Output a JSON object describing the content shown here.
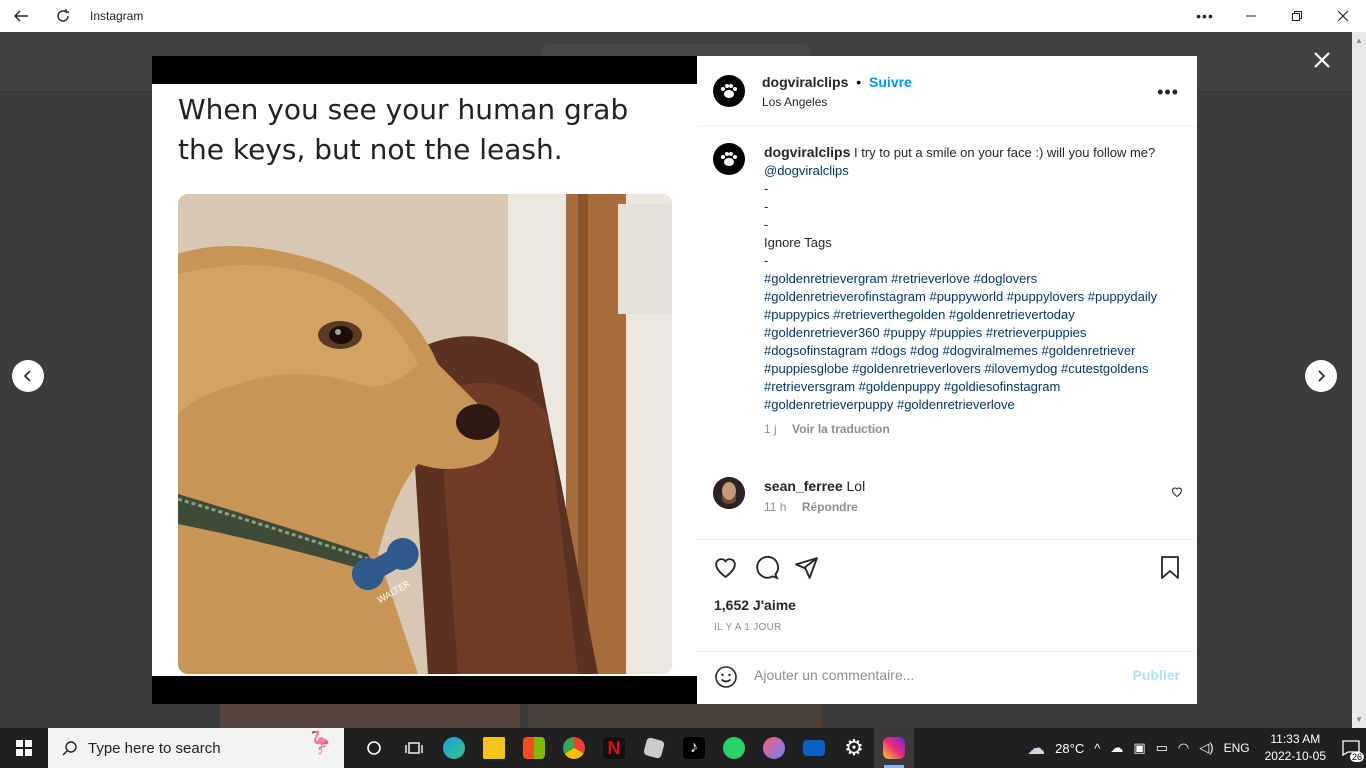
{
  "window": {
    "title": "Instagram"
  },
  "post": {
    "username": "dogviralclips",
    "separator": "•",
    "follow_label": "Suivre",
    "location": "Los Angeles",
    "more_label": "•••",
    "image_caption": "When you see your human grab the keys, but not the leash.",
    "tag_text": "WALTER"
  },
  "caption": {
    "username": "dogviralclips",
    "text": "I try to put a smile on your face :) will you follow me?",
    "mention": "@dogviralclips",
    "dash1": "-",
    "dash2": "-",
    "dash3": "-",
    "ignore": "Ignore Tags",
    "dash4": "-",
    "hashtags": "#goldenretrievergram #retrieverlove #doglovers #goldenretrieverofinstagram #puppyworld #puppylovers #puppydaily #puppypics #retrieverthegolden #goldenretrievertoday #goldenretriever360 #puppy #puppies #retrieverpuppies #dogsofinstagram #dogs #dog #dogviralmemes #goldenretriever #puppiesglobe #goldenretrieverlovers #ilovemydog #cutestgoldens #retrieversgram #goldenpuppy #goldiesofinstagram #goldenretrieverpuppy #goldenretrieverlove",
    "time": "1 j",
    "translate": "Voir la traduction"
  },
  "comment": {
    "username": "sean_ferree",
    "text": "Lol",
    "time": "11 h",
    "reply": "Répondre"
  },
  "stats": {
    "likes": "1,652 J'aime",
    "date": "IL Y A 1 JOUR"
  },
  "add_comment": {
    "placeholder": "Ajouter un commentaire...",
    "publish": "Publier"
  },
  "taskbar": {
    "search_placeholder": "Type here to search",
    "weather": "28°C",
    "lang": "ENG",
    "time": "11:33 AM",
    "date": "2022-10-05",
    "notif_count": "26"
  }
}
